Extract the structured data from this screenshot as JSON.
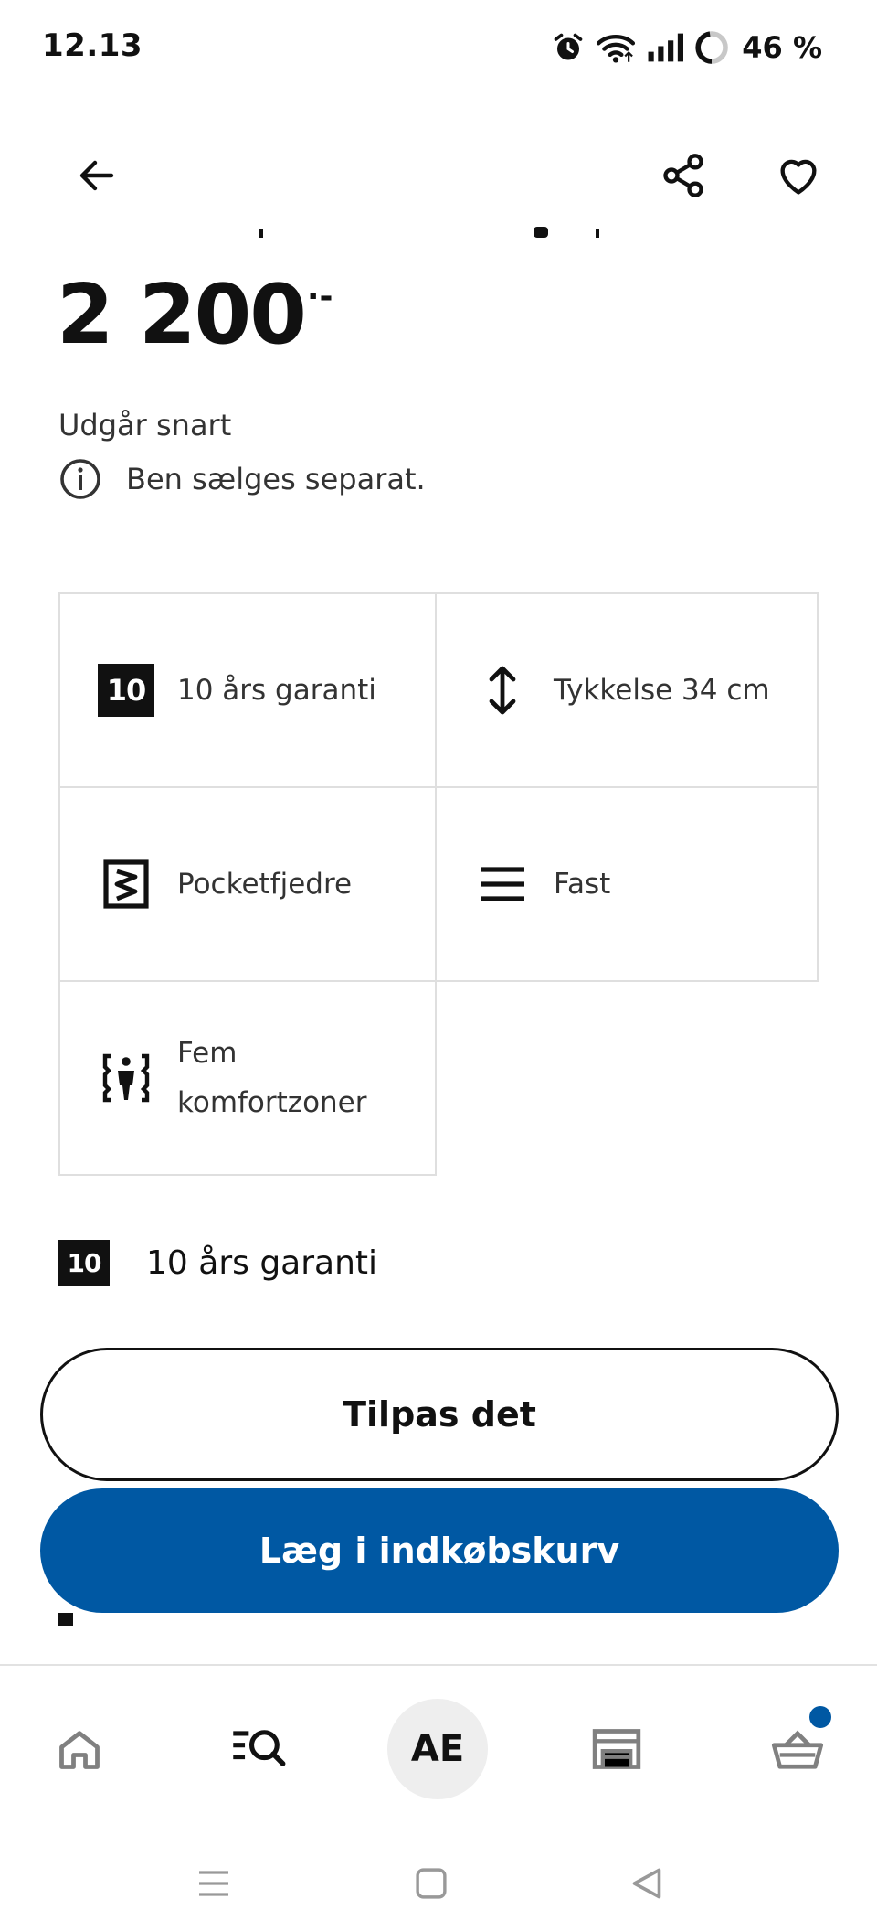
{
  "status_bar": {
    "time": "12.13",
    "battery": "46 %",
    "icons": [
      "alarm-icon",
      "wifi-icon",
      "signal-icon",
      "battery-icon"
    ]
  },
  "top_bar": {
    "icons": [
      "back-arrow-icon",
      "share-icon",
      "heart-icon"
    ]
  },
  "product": {
    "price_integer": "2 200",
    "price_decimal": "·-",
    "status": "Udgår snart",
    "info_note": "Ben sælges separat."
  },
  "features": [
    {
      "icon": "ten-badge",
      "badge": "10",
      "label": "10 års garanti"
    },
    {
      "icon": "thickness-arrow-icon",
      "label": "Tykkelse 34 cm"
    },
    {
      "icon": "pocket-spring-icon",
      "label": "Pocketfjedre"
    },
    {
      "icon": "firmness-lines-icon",
      "label": "Fast"
    },
    {
      "icon": "comfort-zones-icon",
      "label": "Fem komfortzoner"
    }
  ],
  "warranty": {
    "badge": "10",
    "label": "10 års garanti"
  },
  "actions": {
    "customize_label": "Tilpas det",
    "add_to_cart_label": "Læg i indkøbskurv"
  },
  "bottom_nav": {
    "account_initials": "AE",
    "items": [
      "home-icon",
      "search-list-icon",
      "account",
      "store-icon",
      "cart-icon"
    ]
  },
  "colors": {
    "primary": "#0058a3",
    "text": "#111111",
    "border": "#dfdfdf",
    "account_bg": "#eeeeee"
  }
}
